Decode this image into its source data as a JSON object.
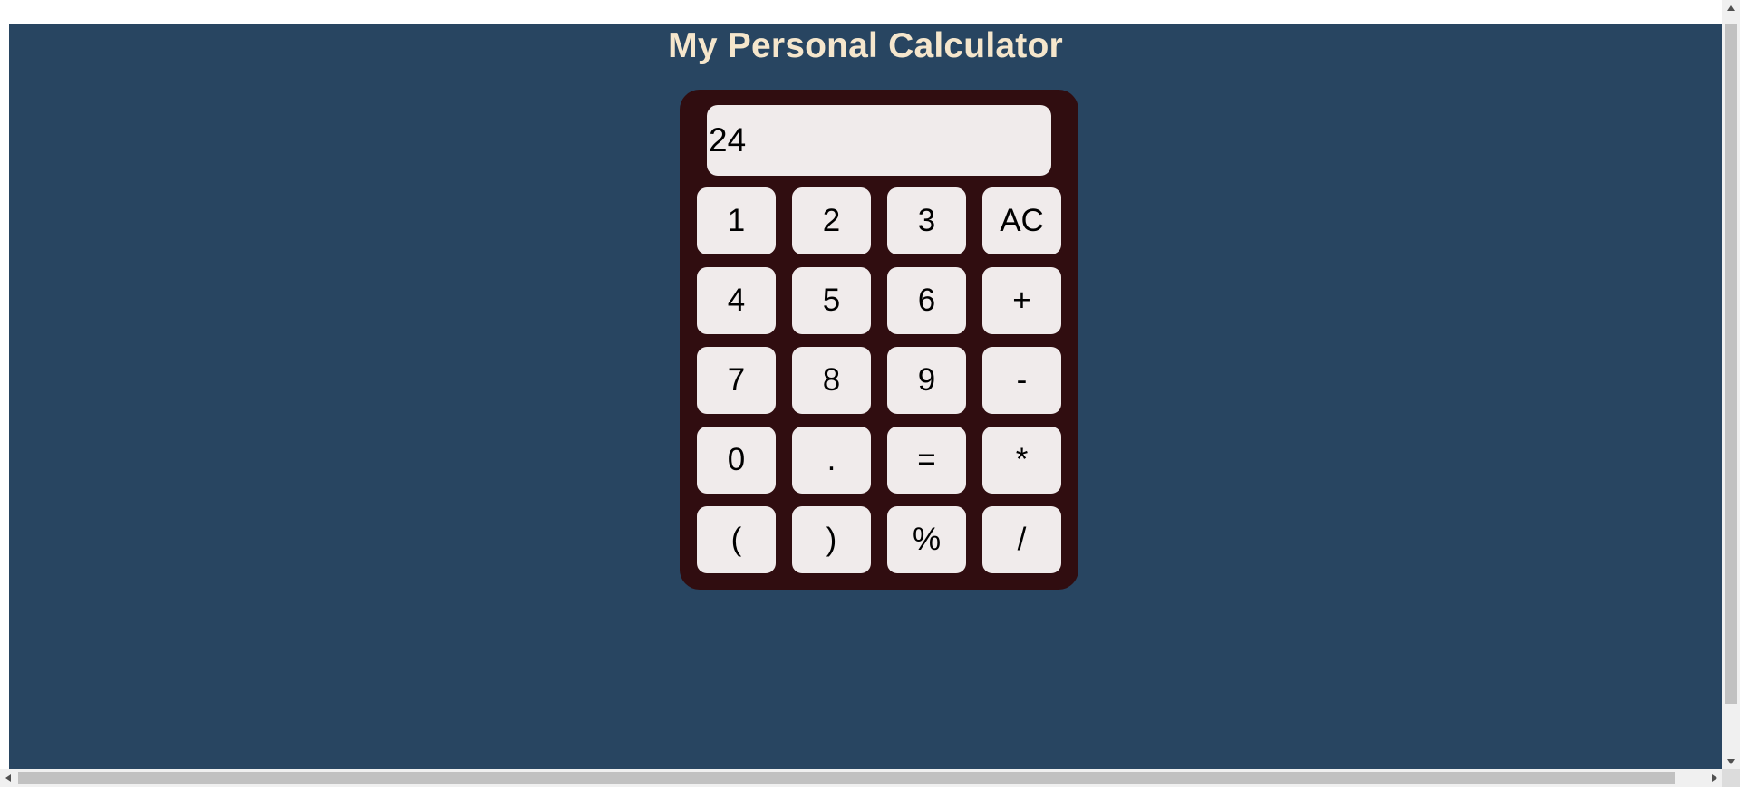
{
  "page": {
    "title": "My Personal Calculator",
    "colors": {
      "background": "#284561",
      "title": "#f5e6cc",
      "calculator_body": "#300d10",
      "key_face": "#f0ebeb",
      "key_text": "#000000"
    }
  },
  "calculator": {
    "display_value": "24",
    "keys": [
      [
        "1",
        "2",
        "3",
        "AC"
      ],
      [
        "4",
        "5",
        "6",
        "+"
      ],
      [
        "7",
        "8",
        "9",
        "-"
      ],
      [
        "0",
        ".",
        "=",
        "*"
      ],
      [
        "(",
        ")",
        "%",
        "/"
      ]
    ]
  },
  "scrollbars": {
    "vertical_up_icon": "triangle-up-icon",
    "vertical_down_icon": "triangle-down-icon",
    "horizontal_left_icon": "triangle-left-icon",
    "horizontal_right_icon": "triangle-right-icon"
  }
}
